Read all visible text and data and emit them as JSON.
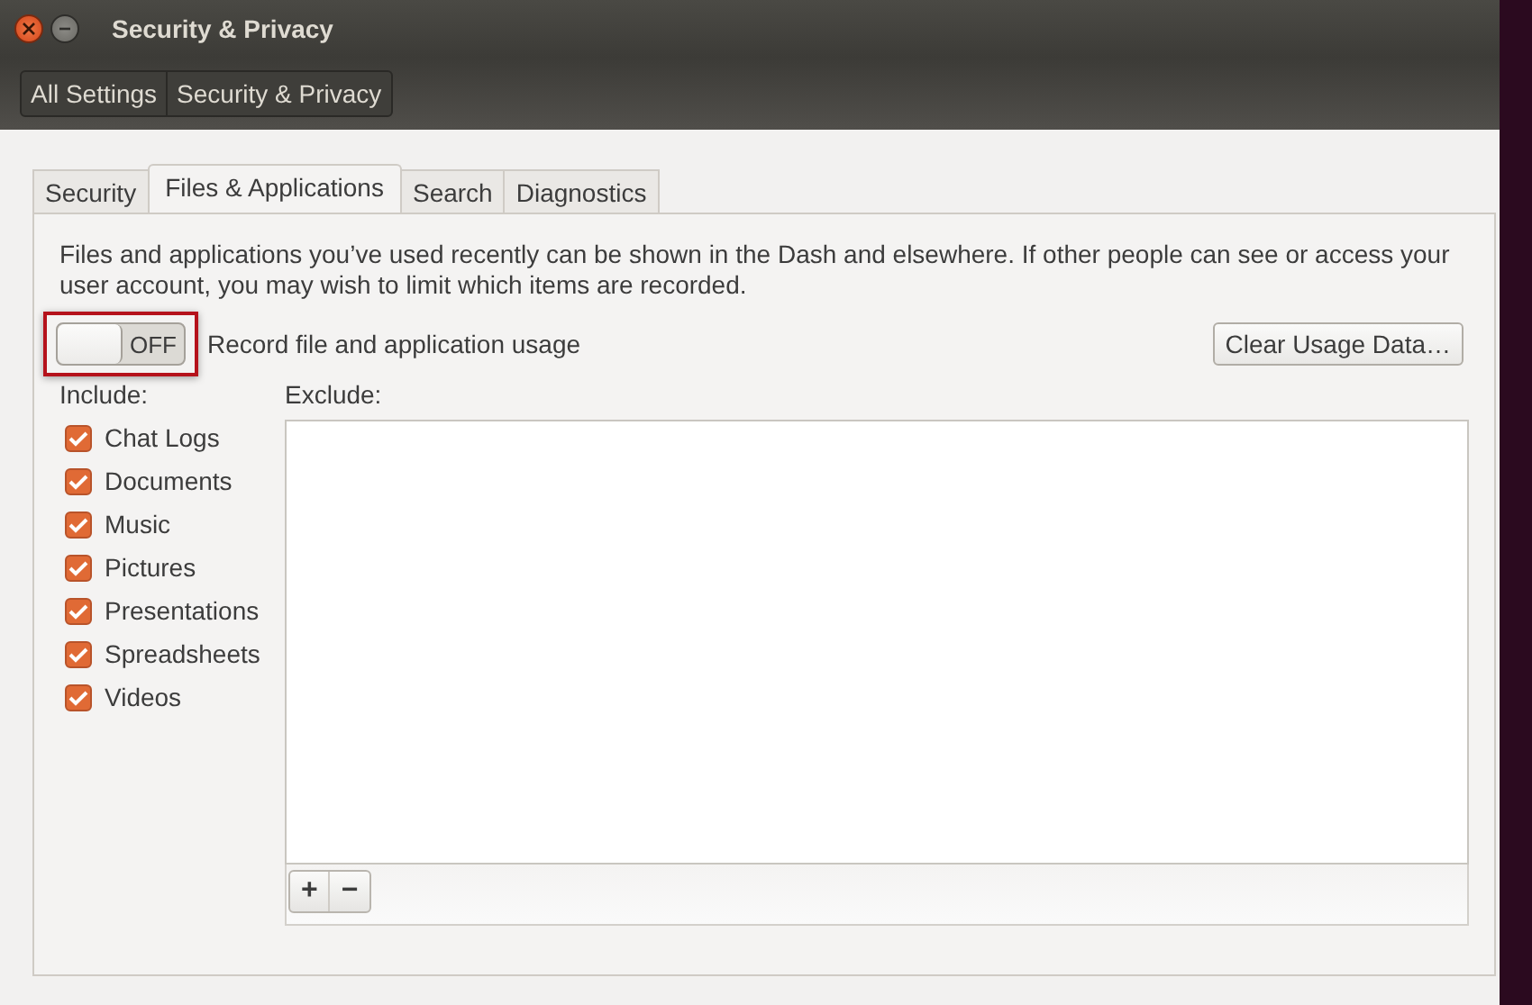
{
  "window": {
    "title": "Security & Privacy"
  },
  "breadcrumbs": [
    {
      "label": "All Settings"
    },
    {
      "label": "Security & Privacy"
    }
  ],
  "tabs": [
    {
      "label": "Security",
      "selected": false
    },
    {
      "label": "Files & Applications",
      "selected": true
    },
    {
      "label": "Search",
      "selected": false
    },
    {
      "label": "Diagnostics",
      "selected": false
    }
  ],
  "description": "Files and applications you’ve used recently can be shown in the Dash and elsewhere. If other people can see or access your user account, you may wish to limit which items are recorded.",
  "record_switch": {
    "state_text": "OFF",
    "on": false,
    "label": "Record file and application usage",
    "highlighted": true
  },
  "clear_button": "Clear Usage Data…",
  "include": {
    "heading": "Include:",
    "items": [
      {
        "label": "Chat Logs",
        "checked": true
      },
      {
        "label": "Documents",
        "checked": true
      },
      {
        "label": "Music",
        "checked": true
      },
      {
        "label": "Pictures",
        "checked": true
      },
      {
        "label": "Presentations",
        "checked": true
      },
      {
        "label": "Spreadsheets",
        "checked": true
      },
      {
        "label": "Videos",
        "checked": true
      }
    ]
  },
  "exclude": {
    "heading": "Exclude:",
    "add_button": "+",
    "remove_button": "−"
  }
}
